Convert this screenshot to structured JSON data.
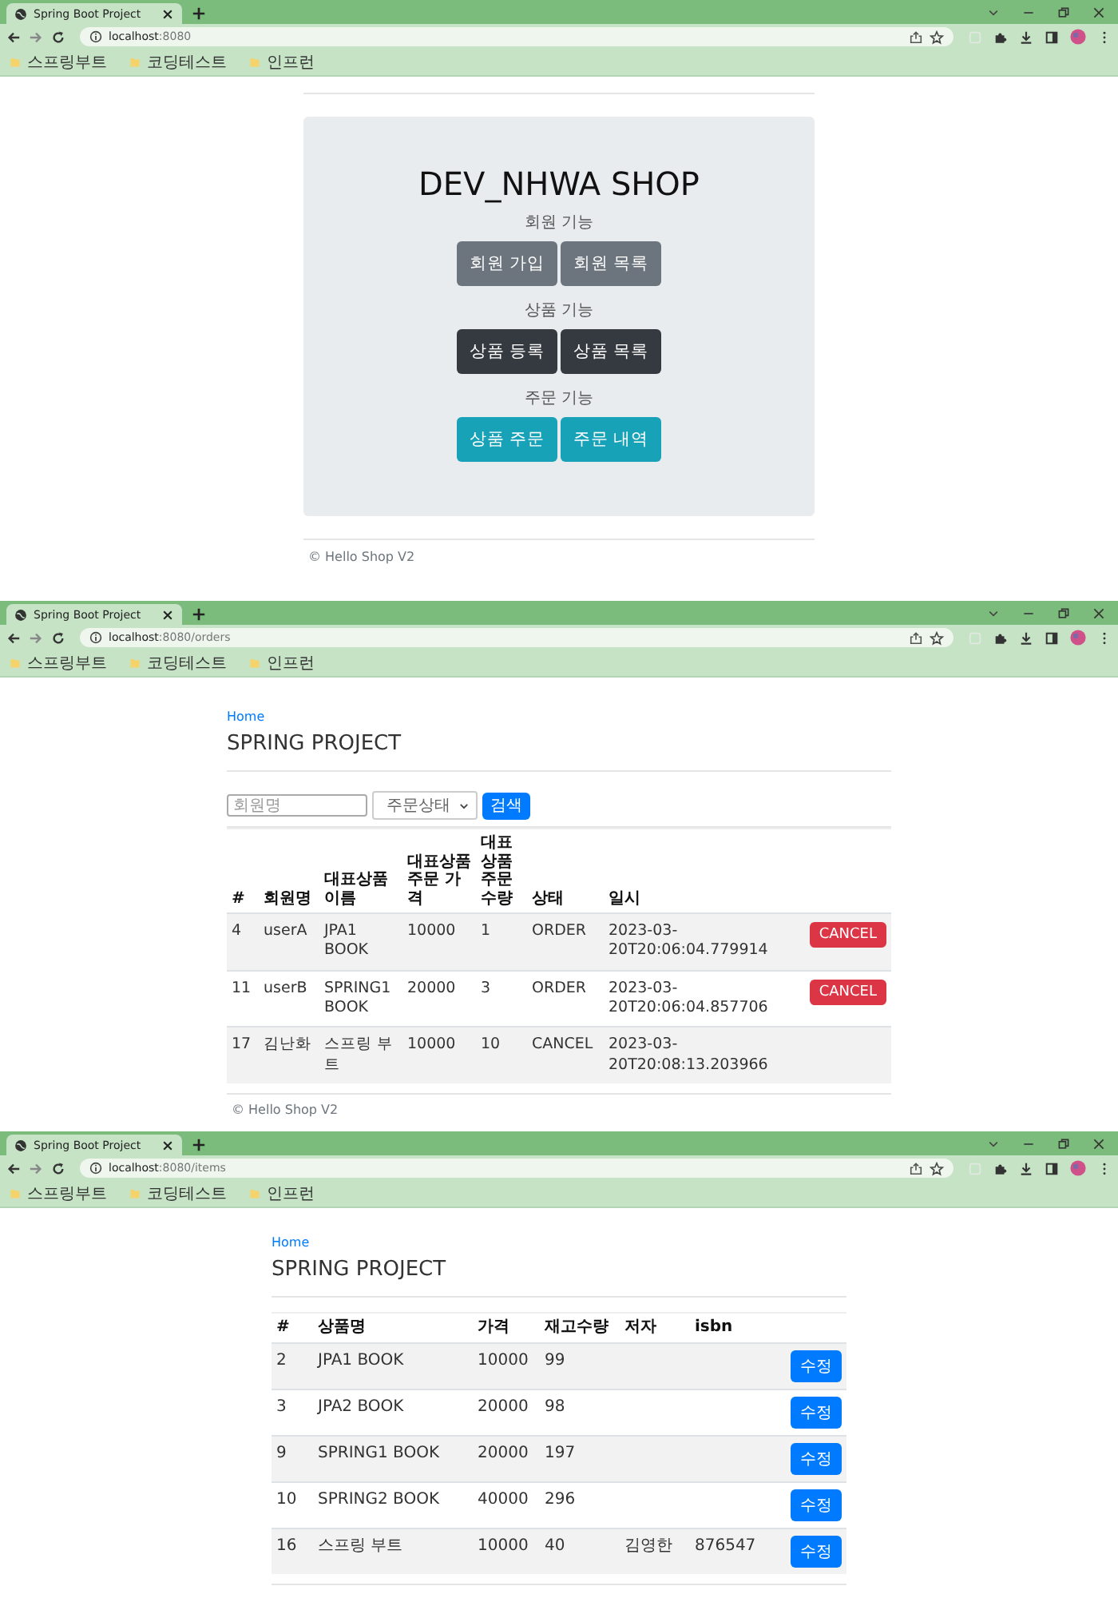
{
  "windows": [
    {
      "tab_title": "Spring Boot Project",
      "url_host": "localhost",
      "url_rest": ":8080",
      "bookmarks": [
        "스프링부트",
        "코딩테스트",
        "인프런"
      ],
      "page": {
        "kind": "home",
        "title": "DEV_NHWA SHOP",
        "sections": [
          {
            "heading": "회원 기능",
            "color": "#6c757d",
            "buttons": [
              "회원 가입",
              "회원 목록"
            ]
          },
          {
            "heading": "상품 기능",
            "color": "#343a40",
            "buttons": [
              "상품 등록",
              "상품 목록"
            ]
          },
          {
            "heading": "주문 기능",
            "color": "#17a2b8",
            "buttons": [
              "상품 주문",
              "주문 내역"
            ]
          }
        ],
        "footer": "© Hello Shop V2"
      }
    },
    {
      "tab_title": "Spring Boot Project",
      "url_host": "localhost",
      "url_rest": ":8080/orders",
      "bookmarks": [
        "스프링부트",
        "코딩테스트",
        "인프런"
      ],
      "page": {
        "kind": "orders",
        "breadcrumb": "Home",
        "title": "SPRING PROJECT",
        "search": {
          "member_placeholder": "회원명",
          "status_value": "주문상태",
          "button": "검색"
        },
        "columns": [
          "#",
          "회원명",
          "대표상품 이름",
          "대표상품 주문 가격",
          "대표상품 주문 수량",
          "상태",
          "일시"
        ],
        "rows": [
          {
            "cells": [
              "4",
              "userA",
              "JPA1 BOOK",
              "10000",
              "1",
              "ORDER",
              "2023-03-20T20:06:04.779914"
            ],
            "action": "CANCEL"
          },
          {
            "cells": [
              "11",
              "userB",
              "SPRING1 BOOK",
              "20000",
              "3",
              "ORDER",
              "2023-03-20T20:06:04.857706"
            ],
            "action": "CANCEL"
          },
          {
            "cells": [
              "17",
              "김난화",
              "스프링 부트",
              "10000",
              "10",
              "CANCEL",
              "2023-03-20T20:08:13.203966"
            ]
          }
        ],
        "footer": "© Hello Shop V2"
      }
    },
    {
      "tab_title": "Spring Boot Project",
      "url_host": "localhost",
      "url_rest": ":8080/items",
      "bookmarks": [
        "스프링부트",
        "코딩테스트",
        "인프런"
      ],
      "page": {
        "kind": "items",
        "breadcrumb": "Home",
        "title": "SPRING PROJECT",
        "columns": [
          "#",
          "상품명",
          "가격",
          "재고수량",
          "저자",
          "isbn"
        ],
        "rows": [
          {
            "cells": [
              "2",
              "JPA1 BOOK",
              "10000",
              "99",
              "",
              ""
            ],
            "action": "수정"
          },
          {
            "cells": [
              "3",
              "JPA2 BOOK",
              "20000",
              "98",
              "",
              ""
            ],
            "action": "수정"
          },
          {
            "cells": [
              "9",
              "SPRING1 BOOK",
              "20000",
              "197",
              "",
              ""
            ],
            "action": "수정"
          },
          {
            "cells": [
              "10",
              "SPRING2 BOOK",
              "40000",
              "296",
              "",
              ""
            ],
            "action": "수정"
          },
          {
            "cells": [
              "16",
              "스프링 부트",
              "10000",
              "40",
              "김영한",
              "876547"
            ],
            "action": "수정"
          }
        ]
      }
    }
  ]
}
